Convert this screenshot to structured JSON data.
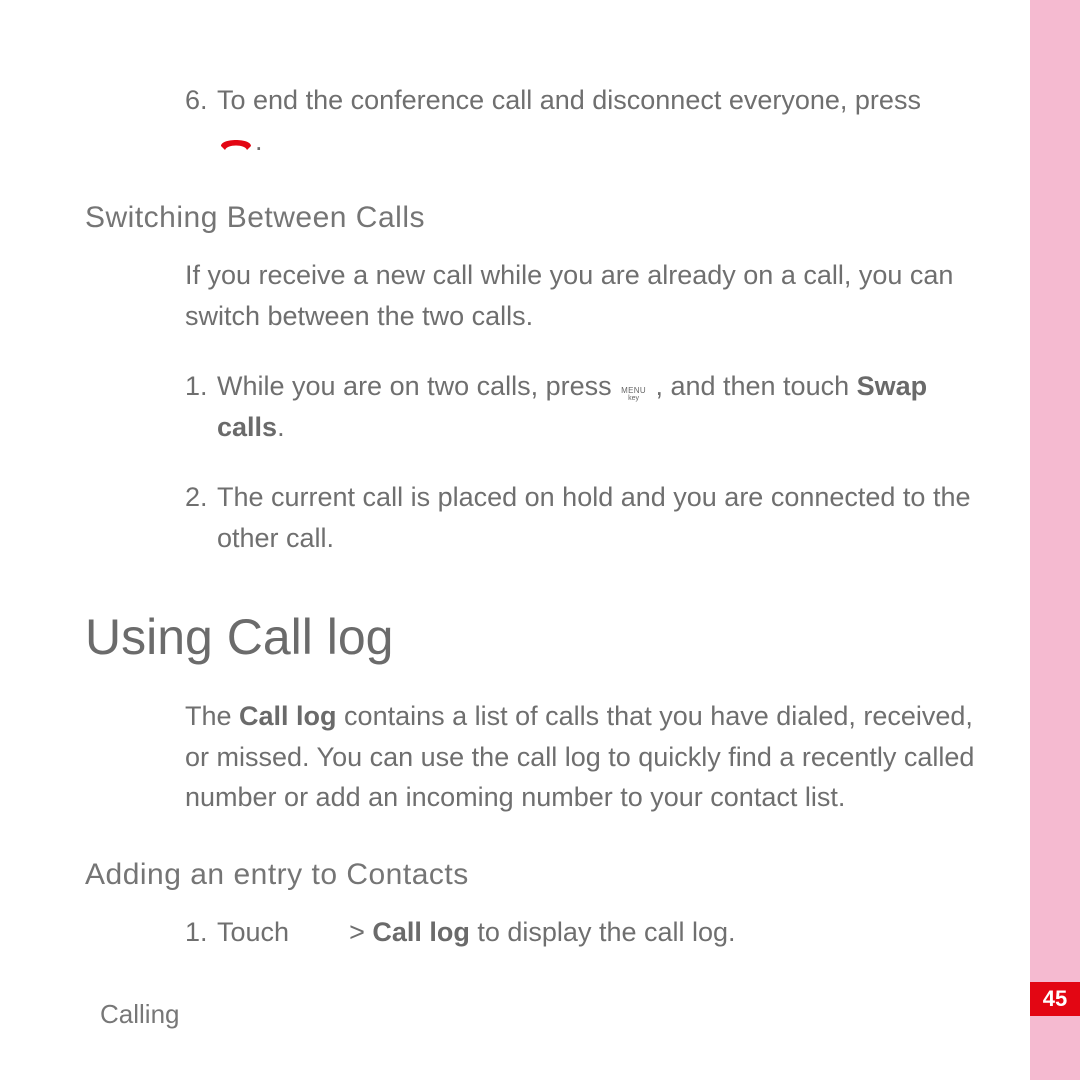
{
  "footer": {
    "section_label": "Calling",
    "page_number": "45"
  },
  "step6": {
    "num": "6.",
    "text": "To end the conference call and disconnect everyone, press",
    "period": "."
  },
  "switching": {
    "heading": "Switching Between Calls",
    "intro": "If you receive a new call while you are already on a call, you can switch between the two calls.",
    "item1": {
      "num": "1.",
      "pre": "While you are on two calls, press ",
      "after_icon": ", and then touch ",
      "bold": "Swap calls",
      "post": "."
    },
    "item2": {
      "num": "2.",
      "text": "The current call is placed on hold and you are connected to the other call."
    }
  },
  "call_log": {
    "heading": "Using Call log",
    "intro_pre": "The ",
    "intro_bold": "Call log",
    "intro_post": " contains a list of calls that you have dialed, received, or missed. You can use the call log to quickly find a recently called number or add an incoming number to your contact list."
  },
  "adding": {
    "heading": "Adding an entry to Contacts",
    "item1": {
      "num": "1.",
      "pre": "Touch ",
      "gap": "      ",
      "gt": " > ",
      "bold": "Call log",
      "post": " to display the call log."
    }
  },
  "icons": {
    "end_call": "end-call-icon",
    "menu_key_line1": "MENU",
    "menu_key_line2": "key"
  }
}
